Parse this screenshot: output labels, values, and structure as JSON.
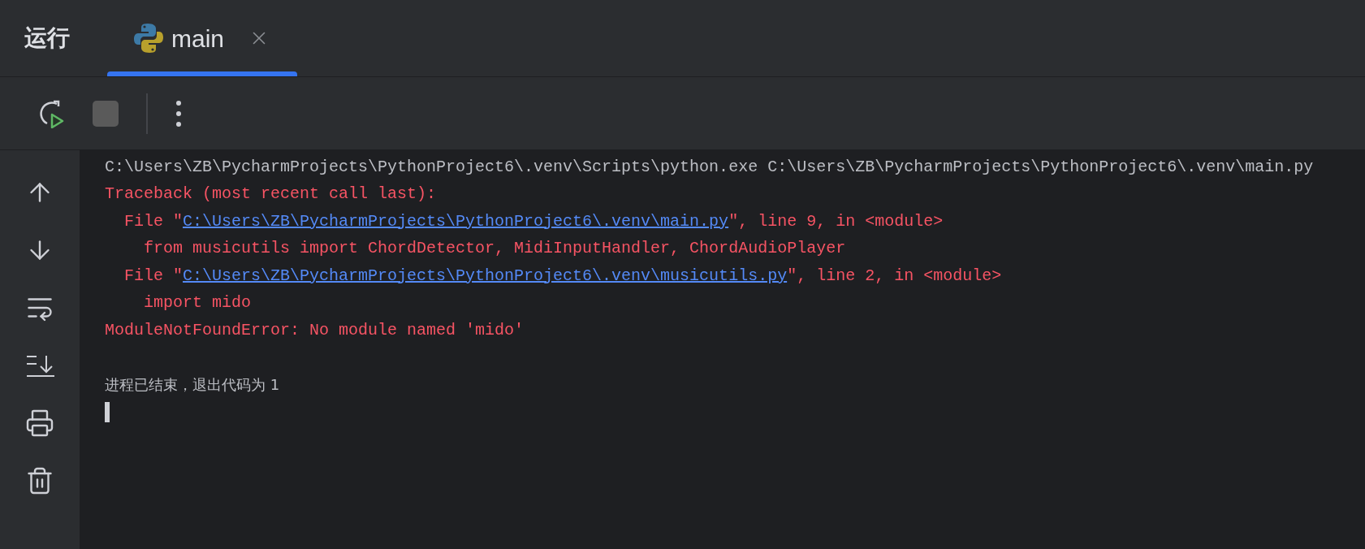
{
  "tool_window": {
    "title": "运行"
  },
  "tabs": [
    {
      "label": "main",
      "selected": true
    }
  ],
  "toolbar": {
    "stop_disabled": true
  },
  "console": {
    "lines": [
      {
        "kind": "command",
        "segments": [
          {
            "text": "C:\\Users\\ZB\\PycharmProjects\\PythonProject6\\.venv\\Scripts\\python.exe C:\\Users\\ZB\\PycharmProjects\\PythonProject6\\.venv\\main.py",
            "link": false
          }
        ]
      },
      {
        "kind": "error",
        "segments": [
          {
            "text": "Traceback (most recent call last):",
            "link": false
          }
        ]
      },
      {
        "kind": "error",
        "segments": [
          {
            "text": "  File \"",
            "link": false
          },
          {
            "text": "C:\\Users\\ZB\\PycharmProjects\\PythonProject6\\.venv\\main.py",
            "link": true
          },
          {
            "text": "\", line 9, in <module>",
            "link": false
          }
        ]
      },
      {
        "kind": "error",
        "segments": [
          {
            "text": "    from musicutils import ChordDetector, MidiInputHandler, ChordAudioPlayer",
            "link": false
          }
        ]
      },
      {
        "kind": "error",
        "segments": [
          {
            "text": "  File \"",
            "link": false
          },
          {
            "text": "C:\\Users\\ZB\\PycharmProjects\\PythonProject6\\.venv\\musicutils.py",
            "link": true
          },
          {
            "text": "\", line 2, in <module>",
            "link": false
          }
        ]
      },
      {
        "kind": "error",
        "segments": [
          {
            "text": "    import mido",
            "link": false
          }
        ]
      },
      {
        "kind": "error",
        "segments": [
          {
            "text": "ModuleNotFoundError: No module named 'mido'",
            "link": false
          }
        ]
      },
      {
        "kind": "blank"
      },
      {
        "kind": "system",
        "segments": [
          {
            "text": "进程已结束，退出代码为 1",
            "link": false
          }
        ]
      },
      {
        "kind": "cursor"
      }
    ]
  }
}
